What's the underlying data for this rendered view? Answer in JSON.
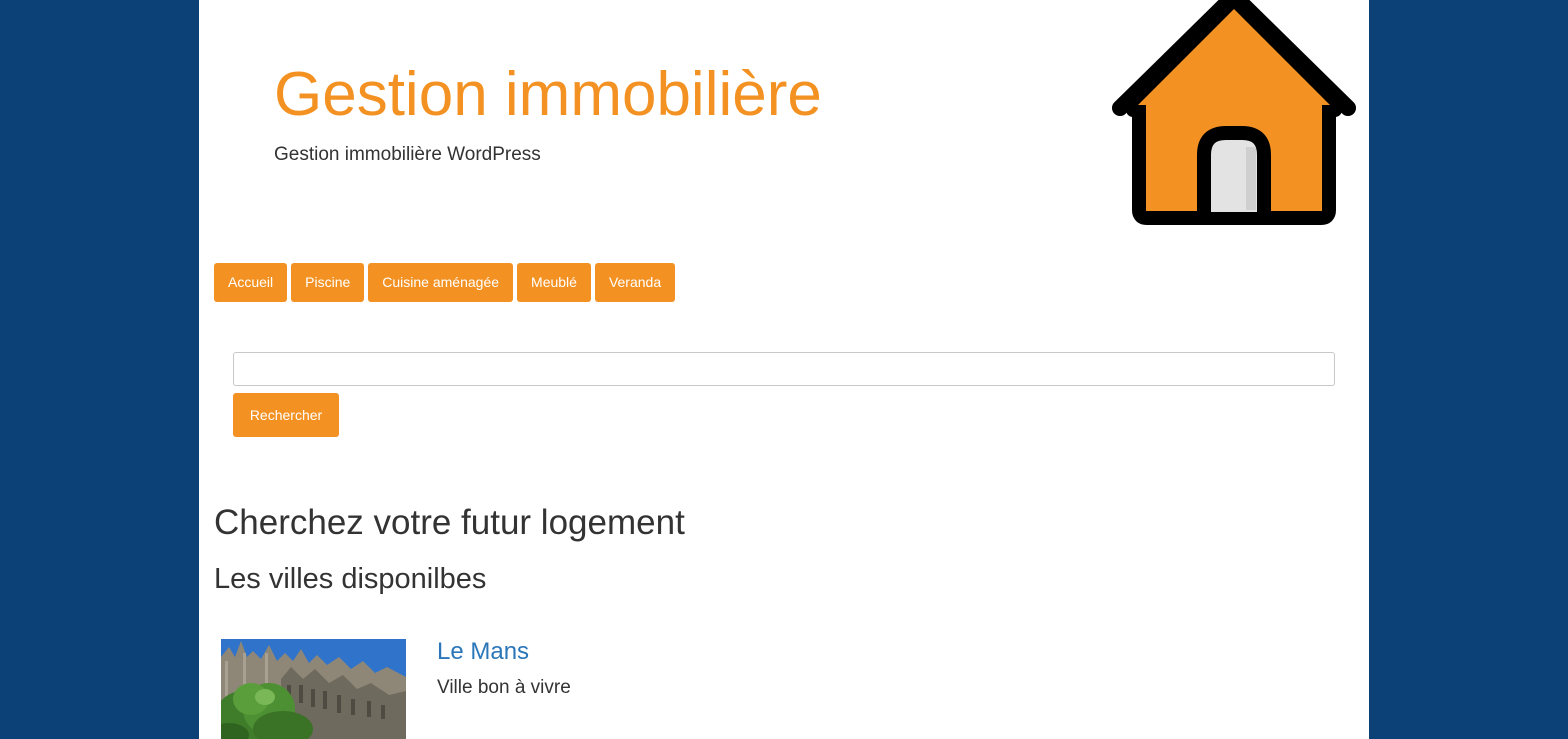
{
  "header": {
    "site_title": "Gestion immobilière",
    "site_tagline": "Gestion immobilière WordPress",
    "logo_icon": "house-icon"
  },
  "nav": {
    "items": [
      {
        "label": "Accueil"
      },
      {
        "label": "Piscine"
      },
      {
        "label": "Cuisine aménagée"
      },
      {
        "label": "Meublé"
      },
      {
        "label": "Veranda"
      }
    ]
  },
  "search": {
    "value": "",
    "placeholder": "",
    "button_label": "Rechercher"
  },
  "main": {
    "heading": "Cherchez votre futur logement",
    "subheading": "Les villes disponilbes",
    "cities": [
      {
        "name": "Le Mans",
        "description": "Ville bon à vivre",
        "thumbnail_icon": "cathedral-photo"
      }
    ]
  },
  "colors": {
    "background": "#0b4176",
    "accent": "#f39223",
    "link": "#2a76b8",
    "text": "#333333"
  }
}
